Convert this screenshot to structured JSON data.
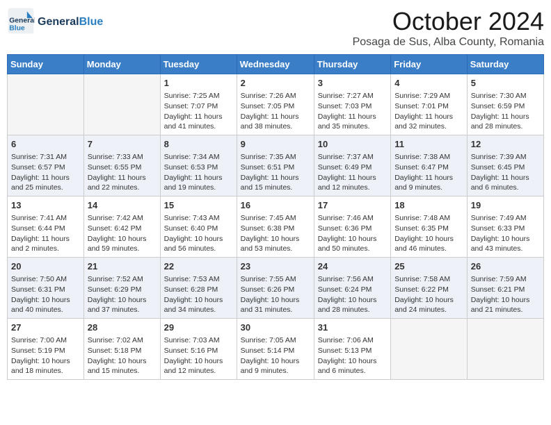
{
  "header": {
    "logo_general": "General",
    "logo_blue": "Blue",
    "month_title": "October 2024",
    "location": "Posaga de Sus, Alba County, Romania"
  },
  "days_of_week": [
    "Sunday",
    "Monday",
    "Tuesday",
    "Wednesday",
    "Thursday",
    "Friday",
    "Saturday"
  ],
  "weeks": [
    {
      "row_class": "row-odd",
      "days": [
        {
          "num": "",
          "content": "",
          "empty": true
        },
        {
          "num": "",
          "content": "",
          "empty": true
        },
        {
          "num": "1",
          "sunrise": "Sunrise: 7:25 AM",
          "sunset": "Sunset: 7:07 PM",
          "daylight": "Daylight: 11 hours and 41 minutes.",
          "empty": false
        },
        {
          "num": "2",
          "sunrise": "Sunrise: 7:26 AM",
          "sunset": "Sunset: 7:05 PM",
          "daylight": "Daylight: 11 hours and 38 minutes.",
          "empty": false
        },
        {
          "num": "3",
          "sunrise": "Sunrise: 7:27 AM",
          "sunset": "Sunset: 7:03 PM",
          "daylight": "Daylight: 11 hours and 35 minutes.",
          "empty": false
        },
        {
          "num": "4",
          "sunrise": "Sunrise: 7:29 AM",
          "sunset": "Sunset: 7:01 PM",
          "daylight": "Daylight: 11 hours and 32 minutes.",
          "empty": false
        },
        {
          "num": "5",
          "sunrise": "Sunrise: 7:30 AM",
          "sunset": "Sunset: 6:59 PM",
          "daylight": "Daylight: 11 hours and 28 minutes.",
          "empty": false
        }
      ]
    },
    {
      "row_class": "row-even",
      "days": [
        {
          "num": "6",
          "sunrise": "Sunrise: 7:31 AM",
          "sunset": "Sunset: 6:57 PM",
          "daylight": "Daylight: 11 hours and 25 minutes.",
          "empty": false
        },
        {
          "num": "7",
          "sunrise": "Sunrise: 7:33 AM",
          "sunset": "Sunset: 6:55 PM",
          "daylight": "Daylight: 11 hours and 22 minutes.",
          "empty": false
        },
        {
          "num": "8",
          "sunrise": "Sunrise: 7:34 AM",
          "sunset": "Sunset: 6:53 PM",
          "daylight": "Daylight: 11 hours and 19 minutes.",
          "empty": false
        },
        {
          "num": "9",
          "sunrise": "Sunrise: 7:35 AM",
          "sunset": "Sunset: 6:51 PM",
          "daylight": "Daylight: 11 hours and 15 minutes.",
          "empty": false
        },
        {
          "num": "10",
          "sunrise": "Sunrise: 7:37 AM",
          "sunset": "Sunset: 6:49 PM",
          "daylight": "Daylight: 11 hours and 12 minutes.",
          "empty": false
        },
        {
          "num": "11",
          "sunrise": "Sunrise: 7:38 AM",
          "sunset": "Sunset: 6:47 PM",
          "daylight": "Daylight: 11 hours and 9 minutes.",
          "empty": false
        },
        {
          "num": "12",
          "sunrise": "Sunrise: 7:39 AM",
          "sunset": "Sunset: 6:45 PM",
          "daylight": "Daylight: 11 hours and 6 minutes.",
          "empty": false
        }
      ]
    },
    {
      "row_class": "row-odd",
      "days": [
        {
          "num": "13",
          "sunrise": "Sunrise: 7:41 AM",
          "sunset": "Sunset: 6:44 PM",
          "daylight": "Daylight: 11 hours and 2 minutes.",
          "empty": false
        },
        {
          "num": "14",
          "sunrise": "Sunrise: 7:42 AM",
          "sunset": "Sunset: 6:42 PM",
          "daylight": "Daylight: 10 hours and 59 minutes.",
          "empty": false
        },
        {
          "num": "15",
          "sunrise": "Sunrise: 7:43 AM",
          "sunset": "Sunset: 6:40 PM",
          "daylight": "Daylight: 10 hours and 56 minutes.",
          "empty": false
        },
        {
          "num": "16",
          "sunrise": "Sunrise: 7:45 AM",
          "sunset": "Sunset: 6:38 PM",
          "daylight": "Daylight: 10 hours and 53 minutes.",
          "empty": false
        },
        {
          "num": "17",
          "sunrise": "Sunrise: 7:46 AM",
          "sunset": "Sunset: 6:36 PM",
          "daylight": "Daylight: 10 hours and 50 minutes.",
          "empty": false
        },
        {
          "num": "18",
          "sunrise": "Sunrise: 7:48 AM",
          "sunset": "Sunset: 6:35 PM",
          "daylight": "Daylight: 10 hours and 46 minutes.",
          "empty": false
        },
        {
          "num": "19",
          "sunrise": "Sunrise: 7:49 AM",
          "sunset": "Sunset: 6:33 PM",
          "daylight": "Daylight: 10 hours and 43 minutes.",
          "empty": false
        }
      ]
    },
    {
      "row_class": "row-even",
      "days": [
        {
          "num": "20",
          "sunrise": "Sunrise: 7:50 AM",
          "sunset": "Sunset: 6:31 PM",
          "daylight": "Daylight: 10 hours and 40 minutes.",
          "empty": false
        },
        {
          "num": "21",
          "sunrise": "Sunrise: 7:52 AM",
          "sunset": "Sunset: 6:29 PM",
          "daylight": "Daylight: 10 hours and 37 minutes.",
          "empty": false
        },
        {
          "num": "22",
          "sunrise": "Sunrise: 7:53 AM",
          "sunset": "Sunset: 6:28 PM",
          "daylight": "Daylight: 10 hours and 34 minutes.",
          "empty": false
        },
        {
          "num": "23",
          "sunrise": "Sunrise: 7:55 AM",
          "sunset": "Sunset: 6:26 PM",
          "daylight": "Daylight: 10 hours and 31 minutes.",
          "empty": false
        },
        {
          "num": "24",
          "sunrise": "Sunrise: 7:56 AM",
          "sunset": "Sunset: 6:24 PM",
          "daylight": "Daylight: 10 hours and 28 minutes.",
          "empty": false
        },
        {
          "num": "25",
          "sunrise": "Sunrise: 7:58 AM",
          "sunset": "Sunset: 6:22 PM",
          "daylight": "Daylight: 10 hours and 24 minutes.",
          "empty": false
        },
        {
          "num": "26",
          "sunrise": "Sunrise: 7:59 AM",
          "sunset": "Sunset: 6:21 PM",
          "daylight": "Daylight: 10 hours and 21 minutes.",
          "empty": false
        }
      ]
    },
    {
      "row_class": "row-odd",
      "days": [
        {
          "num": "27",
          "sunrise": "Sunrise: 7:00 AM",
          "sunset": "Sunset: 5:19 PM",
          "daylight": "Daylight: 10 hours and 18 minutes.",
          "empty": false
        },
        {
          "num": "28",
          "sunrise": "Sunrise: 7:02 AM",
          "sunset": "Sunset: 5:18 PM",
          "daylight": "Daylight: 10 hours and 15 minutes.",
          "empty": false
        },
        {
          "num": "29",
          "sunrise": "Sunrise: 7:03 AM",
          "sunset": "Sunset: 5:16 PM",
          "daylight": "Daylight: 10 hours and 12 minutes.",
          "empty": false
        },
        {
          "num": "30",
          "sunrise": "Sunrise: 7:05 AM",
          "sunset": "Sunset: 5:14 PM",
          "daylight": "Daylight: 10 hours and 9 minutes.",
          "empty": false
        },
        {
          "num": "31",
          "sunrise": "Sunrise: 7:06 AM",
          "sunset": "Sunset: 5:13 PM",
          "daylight": "Daylight: 10 hours and 6 minutes.",
          "empty": false
        },
        {
          "num": "",
          "content": "",
          "empty": true
        },
        {
          "num": "",
          "content": "",
          "empty": true
        }
      ]
    }
  ]
}
